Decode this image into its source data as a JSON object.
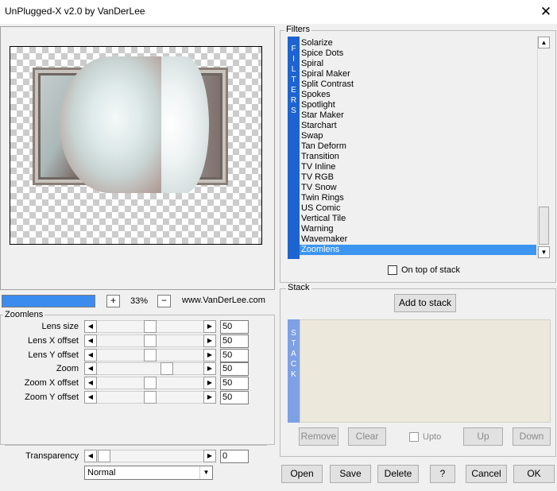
{
  "window": {
    "title": "UnPlugged-X v2.0 by VanDerLee",
    "close_glyph": "✕"
  },
  "zoom": {
    "plus": "+",
    "value": "33%",
    "minus": "−",
    "website": "www.VanDerLee.com"
  },
  "zoomlens": {
    "group_label": "Zoomlens",
    "sliders": [
      {
        "label": "Lens size",
        "value": "50",
        "level": 0.5
      },
      {
        "label": "Lens X offset",
        "value": "50",
        "level": 0.5
      },
      {
        "label": "Lens Y offset",
        "value": "50",
        "level": 0.5
      },
      {
        "label": "Zoom",
        "value": "50",
        "level": 0.68
      },
      {
        "label": "Zoom X offset",
        "value": "50",
        "level": 0.5
      },
      {
        "label": "Zoom Y offset",
        "value": "50",
        "level": 0.5
      }
    ],
    "transparency": {
      "label": "Transparency",
      "value": "0",
      "level": 0
    },
    "blend_mode": "Normal"
  },
  "filters": {
    "group_label": "Filters",
    "vertical_tab": [
      "F",
      "I",
      "L",
      "T",
      "E",
      "R",
      "S"
    ],
    "items": [
      "Solarize",
      "Spice Dots",
      "Spiral",
      "Spiral Maker",
      "Split Contrast",
      "Spokes",
      "Spotlight",
      "Star Maker",
      "Starchart",
      "Swap",
      "Tan Deform",
      "Transition",
      "TV Inline",
      "TV RGB",
      "TV Snow",
      "Twin Rings",
      "US Comic",
      "Vertical Tile",
      "Warning",
      "Wavemaker",
      "Zoomlens"
    ],
    "selected": "Zoomlens",
    "on_top_label": "On top of stack"
  },
  "stack": {
    "group_label": "Stack",
    "add_label": "Add to stack",
    "vertical_tab": [
      "S",
      "T",
      "A",
      "C",
      "K"
    ],
    "remove_label": "Remove",
    "clear_label": "Clear",
    "upto_label": "Upto",
    "up_label": "Up",
    "down_label": "Down"
  },
  "buttons": {
    "open": "Open",
    "save": "Save",
    "delete": "Delete",
    "help": "?",
    "cancel": "Cancel",
    "ok": "OK"
  },
  "colors": {
    "accent": "#3c96f0",
    "filters_tab": "#1e64d0",
    "stack_tab": "#7ea0e4",
    "list_bg": "#ece8dc"
  }
}
